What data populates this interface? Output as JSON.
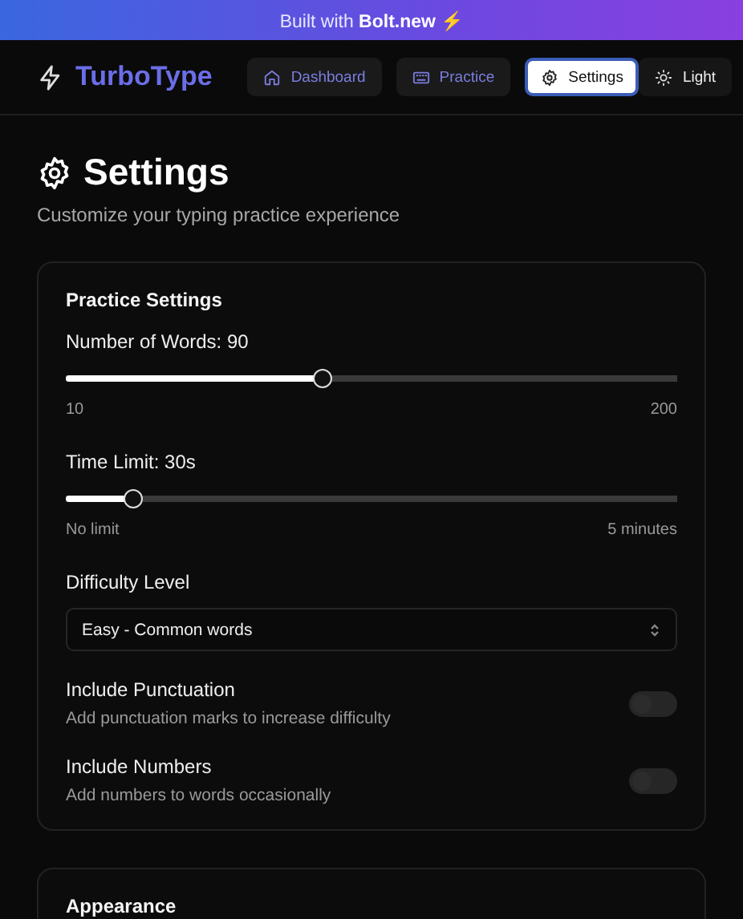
{
  "banner": {
    "text": "Built with **Bolt.new** ⚡"
  },
  "header": {
    "logo": "TurboType",
    "nav": [
      {
        "label": "Dashboard",
        "selected": false
      },
      {
        "label": "Practice",
        "selected": false
      },
      {
        "label": "Settings",
        "selected": true
      }
    ],
    "theme_button": "Light"
  },
  "page": {
    "title": "Settings",
    "subtitle": "Customize your typing practice experience"
  },
  "cards": [
    {
      "title": "Practice Settings",
      "items": [
        {
          "kind": "slider",
          "label": "Number of Words: 90",
          "level": 0.42,
          "min_label": "10",
          "max_label": "200"
        },
        {
          "kind": "slider",
          "label": "Time Limit: 30s",
          "level": 0.11,
          "min_label": "No limit",
          "max_label": "5 minutes"
        },
        {
          "kind": "select",
          "label": "Difficulty Level",
          "value": "Easy - Common words"
        },
        {
          "kind": "toggle",
          "label": "Include Punctuation",
          "description": "Add punctuation marks to increase difficulty",
          "on": false
        },
        {
          "kind": "toggle",
          "label": "Include Numbers",
          "description": "Add numbers to words occasionally",
          "on": false
        }
      ]
    },
    {
      "title": "Appearance"
    }
  ]
}
